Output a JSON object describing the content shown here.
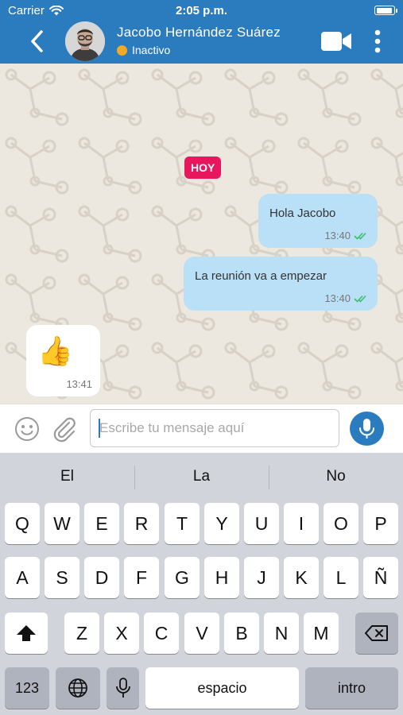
{
  "status_bar": {
    "carrier": "Carrier",
    "time": "2:05 p.m.",
    "battery_level": 0.95
  },
  "header": {
    "contact_name": "Jacobo Hernández Suárez",
    "presence_status": "Inactivo",
    "presence_color": "#f4a823",
    "accent_color": "#2b7bbf",
    "icons": {
      "back": "chevron-left-icon",
      "video": "video-camera-icon",
      "more": "more-vertical-icon"
    }
  },
  "chat": {
    "day_badge": "HOY",
    "messages": [
      {
        "direction": "outgoing",
        "text": "Hola Jacobo",
        "time": "13:40",
        "status": "read"
      },
      {
        "direction": "outgoing",
        "text": "La reunión va a empezar",
        "time": "13:40",
        "status": "read"
      },
      {
        "direction": "incoming",
        "emoji": "👍",
        "time": "13:41"
      }
    ]
  },
  "composer": {
    "placeholder": "Escribe tu mensaje aquí",
    "value": "",
    "icons": {
      "emoji": "smiley-icon",
      "attach": "paperclip-icon",
      "send": "microphone-icon"
    }
  },
  "keyboard": {
    "suggestions": [
      "El",
      "La",
      "No"
    ],
    "row1": [
      "Q",
      "W",
      "E",
      "R",
      "T",
      "Y",
      "U",
      "I",
      "O",
      "P"
    ],
    "row2": [
      "A",
      "S",
      "D",
      "F",
      "G",
      "H",
      "J",
      "K",
      "L",
      "Ñ"
    ],
    "row3": [
      "Z",
      "X",
      "C",
      "V",
      "B",
      "N",
      "M"
    ],
    "numbers_key": "123",
    "space_key": "espacio",
    "return_key": "intro",
    "icons": {
      "shift": "shift-icon",
      "delete": "backspace-icon",
      "globe": "globe-icon",
      "dictation": "microphone-icon"
    }
  }
}
